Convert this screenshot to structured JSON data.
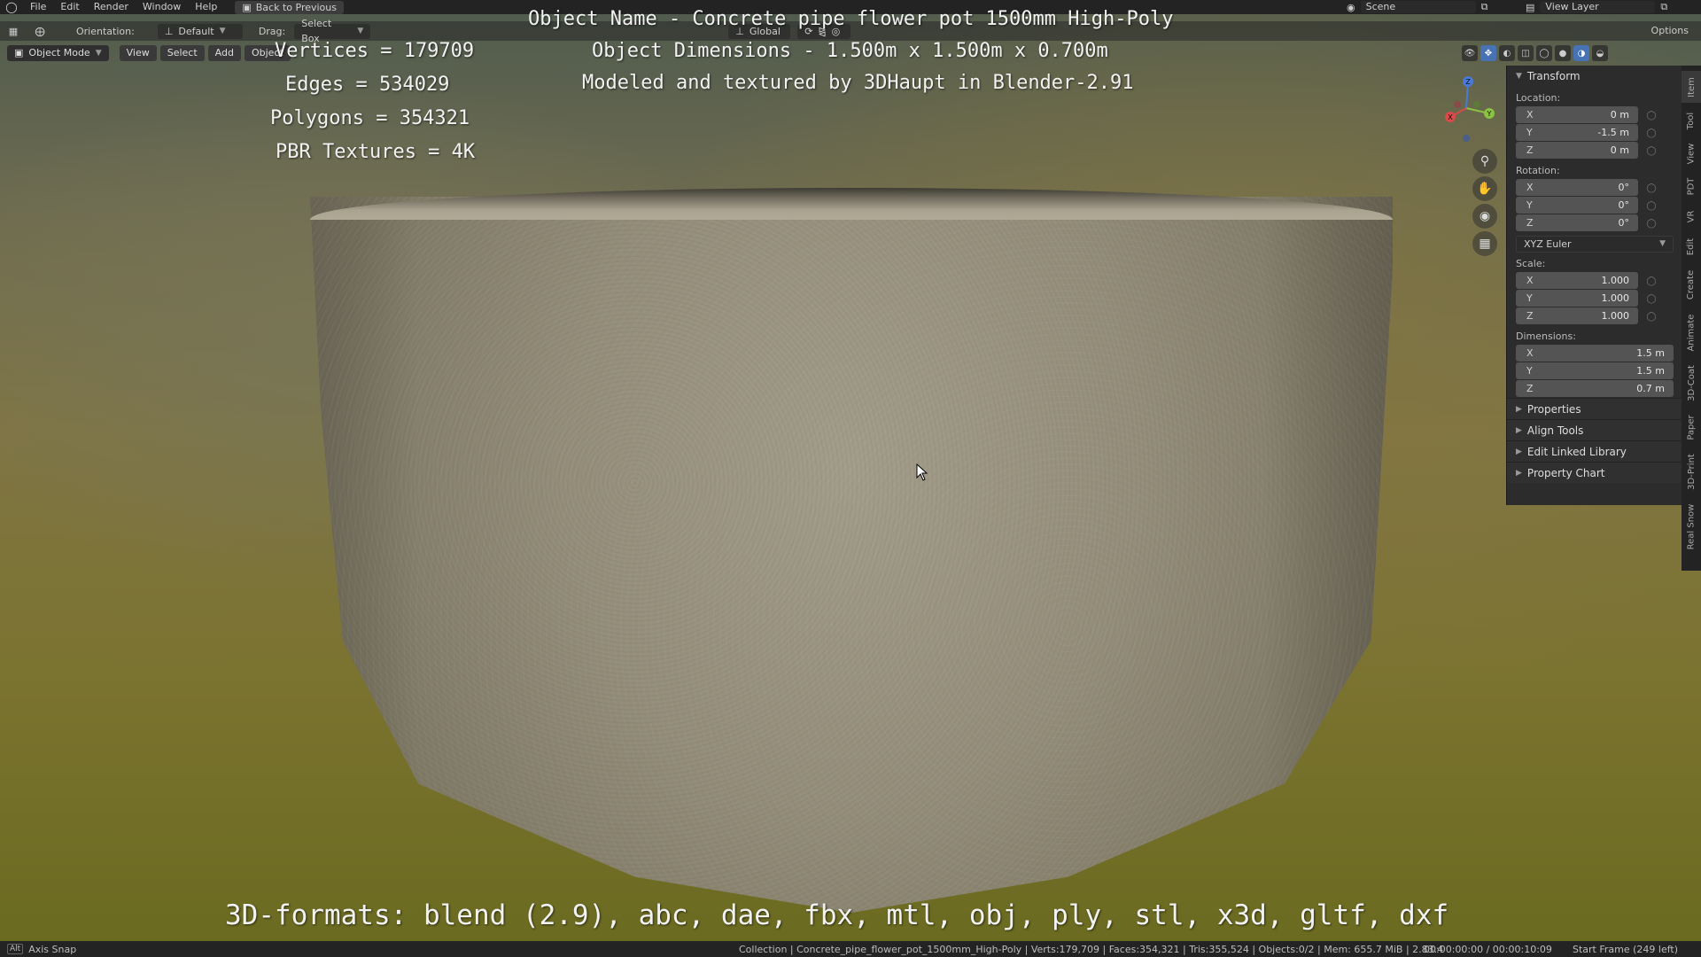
{
  "topbar": {
    "menus": [
      "File",
      "Edit",
      "Render",
      "Window",
      "Help"
    ],
    "back_label": "Back to Previous",
    "scene_label": "Scene",
    "view_layer_label": "View Layer"
  },
  "toolbar": {
    "orientation_label": "Orientation:",
    "orientation_value": "Default",
    "drag_label": "Drag:",
    "drag_value": "Select Box",
    "transform_space": "Global",
    "options_label": "Options"
  },
  "header": {
    "mode": "Object Mode",
    "buttons": [
      "View",
      "Select",
      "Add",
      "Object"
    ]
  },
  "overlay": {
    "vertices": "Vertices = 179709",
    "edges": "Edges = 534029",
    "polygons": "Polygons = 354321",
    "textures": "PBR Textures = 4K",
    "object_name": "Object Name - Concrete pipe flower pot 1500mm High-Poly",
    "object_dimensions": "Object Dimensions -  1.500m x 1.500m x 0.700m",
    "modeled_by": "Modeled and textured by 3DHaupt in Blender-2.91",
    "formats": "3D-formats: blend (2.9), abc, dae, fbx, mtl, obj, ply, stl, x3d, gltf, dxf"
  },
  "npanel": {
    "transform_title": "Transform",
    "location_label": "Location:",
    "location": [
      {
        "axis": "X",
        "value": "0 m"
      },
      {
        "axis": "Y",
        "value": "-1.5 m"
      },
      {
        "axis": "Z",
        "value": "0 m"
      }
    ],
    "rotation_label": "Rotation:",
    "rotation": [
      {
        "axis": "X",
        "value": "0°"
      },
      {
        "axis": "Y",
        "value": "0°"
      },
      {
        "axis": "Z",
        "value": "0°"
      }
    ],
    "rotation_mode": "XYZ Euler",
    "scale_label": "Scale:",
    "scale": [
      {
        "axis": "X",
        "value": "1.000"
      },
      {
        "axis": "Y",
        "value": "1.000"
      },
      {
        "axis": "Z",
        "value": "1.000"
      }
    ],
    "dimensions_label": "Dimensions:",
    "dimensions": [
      {
        "axis": "X",
        "value": "1.5 m"
      },
      {
        "axis": "Y",
        "value": "1.5 m"
      },
      {
        "axis": "Z",
        "value": "0.7 m"
      }
    ],
    "subpanels": [
      "Properties",
      "Align Tools",
      "Edit Linked Library",
      "Property Chart"
    ]
  },
  "tabs": [
    "Item",
    "Tool",
    "View",
    "PDT",
    "VR",
    "Edit",
    "Create",
    "Animate",
    "3D-Coat",
    "Paper",
    "3D-Print",
    "Real Snow"
  ],
  "gizmo": {
    "x": "X",
    "y": "Y",
    "z": "Z"
  },
  "statusbar": {
    "key": "Alt",
    "hint": "Axis Snap",
    "stats": "Collection | Concrete_pipe_flower_pot_1500mm_High-Poly | Verts:179,709 | Faces:354,321 | Tris:355,524 | Objects:0/2 | Mem: 655.7 MiB | 2.83.4",
    "time": "00:00:00:00 / 00:00:10:09",
    "frame": "Start Frame (249 left)"
  }
}
